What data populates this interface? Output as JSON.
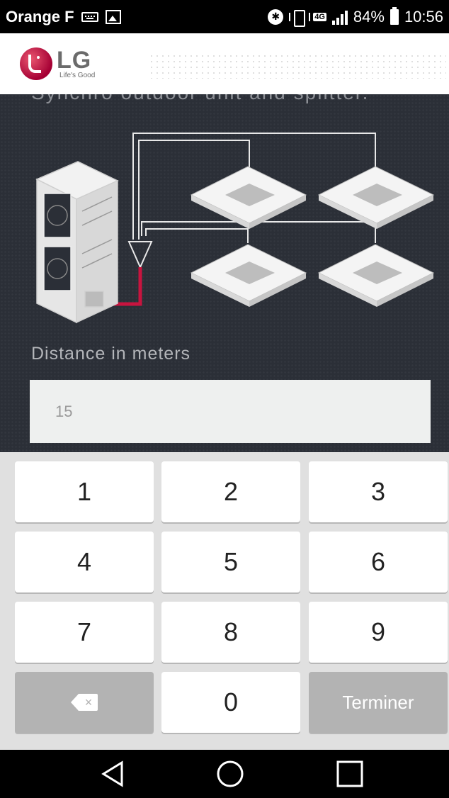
{
  "status_bar": {
    "carrier": "Orange F",
    "network": "4G",
    "battery": "84%",
    "time": "10:56"
  },
  "header": {
    "brand": "LG",
    "tagline": "Life's Good",
    "accent_color": "#a50034"
  },
  "main": {
    "heading_partial": "Synchro outdoor unit and splitter.",
    "distance_label": "Distance in meters",
    "distance_value": "15",
    "pipe_color": "#c8143f"
  },
  "keypad": {
    "keys": [
      "1",
      "2",
      "3",
      "4",
      "5",
      "6",
      "7",
      "8",
      "9",
      "",
      "0",
      "Terminer"
    ],
    "backspace_icon": "backspace-icon",
    "done_label": "Terminer"
  },
  "nav": {
    "back_icon": "back-icon",
    "home_icon": "home-icon",
    "recents_icon": "recents-icon"
  }
}
